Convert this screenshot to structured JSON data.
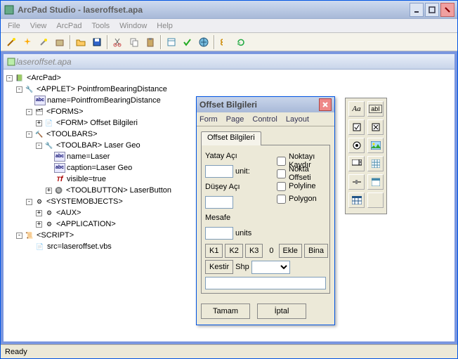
{
  "window": {
    "title": "ArcPad Studio - laseroffset.apa",
    "mdi_title": "laseroffset.apa"
  },
  "menubar": [
    "File",
    "View",
    "ArcPad",
    "Tools",
    "Window",
    "Help"
  ],
  "status": "Ready",
  "tree": {
    "root": "<ArcPad>",
    "applet": "<APPLET> PointfromBearingDistance",
    "applet_name": "name=PointfromBearingDistance",
    "forms": "<FORMS>",
    "form1": "<FORM> Offset Bilgileri",
    "toolbars": "<TOOLBARS>",
    "toolbar1": "<TOOLBAR> Laser Geo",
    "tb_name": "name=Laser",
    "tb_caption": "caption=Laser Geo",
    "tb_visible": "visible=true",
    "tb_btn": "<TOOLBUTTON> LaserButton",
    "sysobj": "<SYSTEMOBJECTS>",
    "aux": "<AUX>",
    "app": "<APPLICATION>",
    "script": "<SCRIPT>",
    "src": "src=laseroffset.vbs"
  },
  "dialog": {
    "title": "Offset Bilgileri",
    "menu": [
      "Form",
      "Page",
      "Control",
      "Layout"
    ],
    "tab": "Offset Bilgileri",
    "yatay": "Yatay Açı",
    "dusey": "Düşey Açı",
    "mesafe": "Mesafe",
    "unit": "unit:",
    "units": "units",
    "chk_noktayi": "Noktayı Kaydır",
    "chk_nokta": "Nokta Offseti",
    "chk_polyline": "Polyline",
    "chk_polygon": "Polygon",
    "k1": "K1",
    "k2": "K2",
    "k3": "K3",
    "zero": "0",
    "ekle": "Ekle",
    "bina": "Bina",
    "kestir": "Kestir",
    "shp": "Shp",
    "tamam": "Tamam",
    "iptal": "İptal"
  },
  "toolbox": {
    "aa": "Aa",
    "abl": "abI"
  }
}
